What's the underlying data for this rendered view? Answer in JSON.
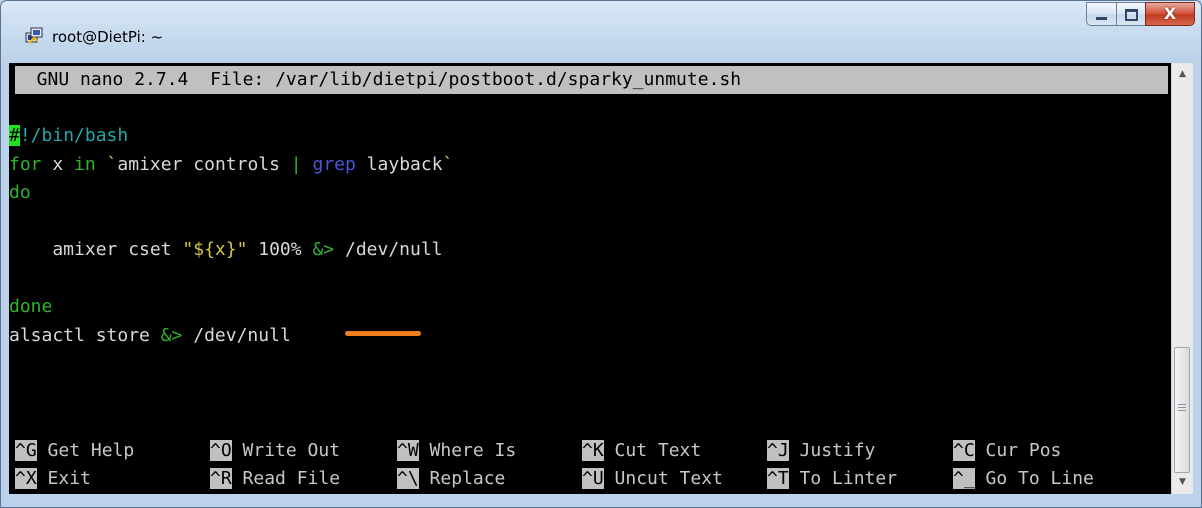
{
  "window": {
    "title": "root@DietPi: ~",
    "icon": "putty-icon",
    "controls": {
      "minimize": "minimize-icon",
      "maximize": "maximize-icon",
      "close_label": "X"
    }
  },
  "nano": {
    "header": "  GNU nano 2.7.4  File: /var/lib/dietpi/postboot.d/sparky_unmute.sh",
    "lines": {
      "l1_cursor": "#",
      "l1_rest": "!/bin/bash",
      "l2_for": "for",
      "l2_x": " x ",
      "l2_in": "in",
      "l2_tick1": " `",
      "l2_cmd": "amixer controls ",
      "l2_pipe": "|",
      "l2_sp": " ",
      "l2_grep": "grep",
      "l2_arg": " layback",
      "l2_tick2": "`",
      "l3_do": "do",
      "l5_cmd": "    amixer cset ",
      "l5_var": "\"${x}\"",
      "l5_pct": " 100%",
      "l5_sp": " ",
      "l5_redir": "&>",
      "l5_dev": " /dev/null",
      "l7_done": "done",
      "l8_cmd": "alsactl store ",
      "l8_redir": "&>",
      "l8_dev": " /dev/null"
    },
    "shortcuts": [
      {
        "key": "^G",
        "label": " Get Help"
      },
      {
        "key": "^O",
        "label": " Write Out"
      },
      {
        "key": "^W",
        "label": " Where Is"
      },
      {
        "key": "^K",
        "label": " Cut Text"
      },
      {
        "key": "^J",
        "label": " Justify"
      },
      {
        "key": "^C",
        "label": " Cur Pos"
      },
      {
        "key": "^X",
        "label": " Exit"
      },
      {
        "key": "^R",
        "label": " Read File"
      },
      {
        "key": "^\\",
        "label": " Replace"
      },
      {
        "key": "^U",
        "label": " Uncut Text"
      },
      {
        "key": "^T",
        "label": " To Linter"
      },
      {
        "key": "^_",
        "label": " Go To Line"
      }
    ]
  },
  "colors": {
    "terminal_bg": "#000000",
    "keyword_green": "#2fb32f",
    "string_yellow": "#d4c44a",
    "highlight_orange": "#f07e1f"
  }
}
